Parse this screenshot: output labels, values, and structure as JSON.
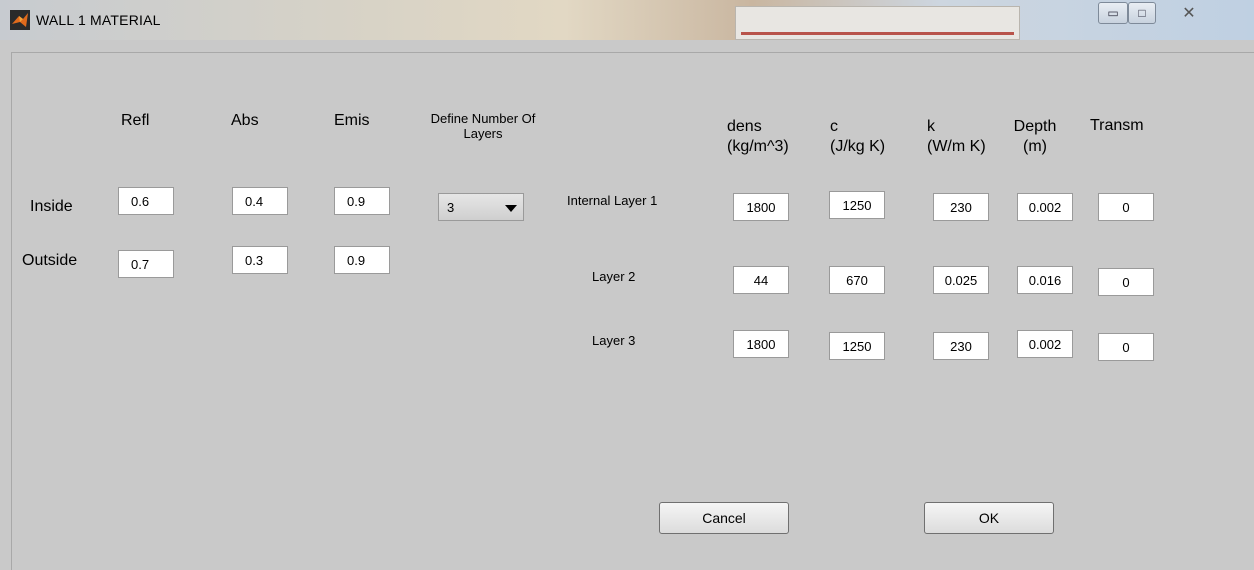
{
  "window": {
    "title": "WALL 1 MATERIAL"
  },
  "headers": {
    "refl": "Refl",
    "abs": "Abs",
    "emis": "Emis",
    "define_layers_line1": "Define Number Of",
    "define_layers_line2": "Layers",
    "dens_line1": "dens",
    "dens_line2": "(kg/m^3)",
    "c_line1": "c",
    "c_line2": "(J/kg K)",
    "k_line1": "k",
    "k_line2": "(W/m K)",
    "depth_line1": "Depth",
    "depth_line2": "(m)",
    "transm": "Transm"
  },
  "surfaces": {
    "inside": {
      "label": "Inside",
      "refl": "0.6",
      "abs": "0.4",
      "emis": "0.9"
    },
    "outside": {
      "label": "Outside",
      "refl": "0.7",
      "abs": "0.3",
      "emis": "0.9"
    }
  },
  "num_layers": {
    "selected": "3"
  },
  "layers": [
    {
      "label": "Internal Layer 1",
      "dens": "1800",
      "c": "1250",
      "k": "230",
      "depth": "0.002",
      "transm": "0"
    },
    {
      "label": "Layer 2",
      "dens": "44",
      "c": "670",
      "k": "0.025",
      "depth": "0.016",
      "transm": "0"
    },
    {
      "label": "Layer 3",
      "dens": "1800",
      "c": "1250",
      "k": "230",
      "depth": "0.002",
      "transm": "0"
    }
  ],
  "buttons": {
    "cancel": "Cancel",
    "ok": "OK"
  },
  "colors": {
    "background": "#c9c9c9",
    "field": "#ffffff"
  }
}
